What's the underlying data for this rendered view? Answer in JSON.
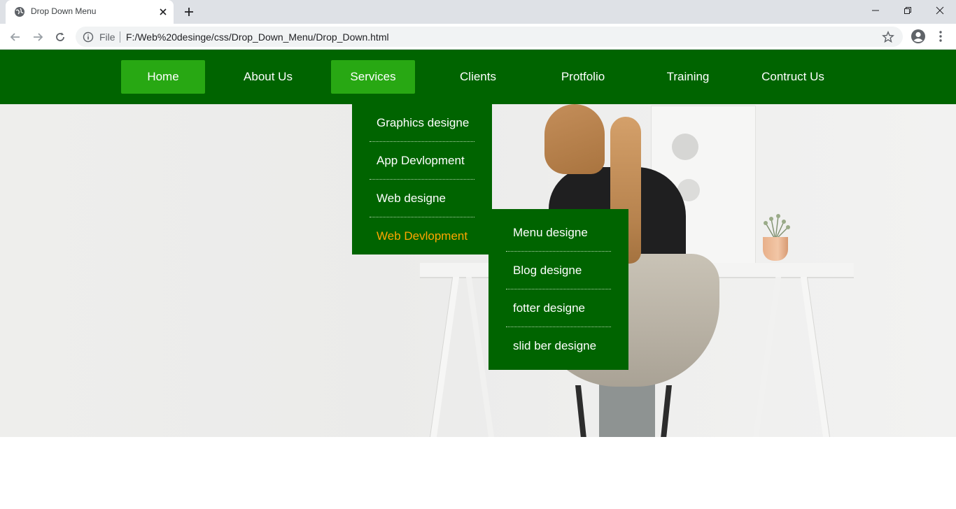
{
  "browser": {
    "tab_title": "Drop Down Menu",
    "url_scheme_label": "File",
    "url": "F:/Web%20desinge/css/Drop_Down_Menu/Drop_Down.html",
    "icons": [
      "globe-icon",
      "close-icon",
      "plus-icon",
      "minimize-icon",
      "restore-icon",
      "window-close-icon",
      "back-icon",
      "forward-icon",
      "reload-icon",
      "info-icon",
      "star-icon",
      "profile-icon",
      "more-vertical-icon"
    ]
  },
  "nav": {
    "items": [
      {
        "label": "Home",
        "active": true
      },
      {
        "label": "About Us",
        "active": false
      },
      {
        "label": "Services",
        "active": true
      },
      {
        "label": "Clients",
        "active": false
      },
      {
        "label": "Protfolio",
        "active": false
      },
      {
        "label": "Training",
        "active": false
      },
      {
        "label": "Contruct Us",
        "active": false
      }
    ]
  },
  "dropdown": {
    "items": [
      {
        "label": "Graphics designe"
      },
      {
        "label": "App Devlopment"
      },
      {
        "label": "Web designe"
      },
      {
        "label": "Web Devlopment"
      }
    ]
  },
  "submenu": {
    "items": [
      {
        "label": "Menu designe"
      },
      {
        "label": "Blog designe"
      },
      {
        "label": "fotter designe"
      },
      {
        "label": "slid ber designe"
      }
    ]
  },
  "colors": {
    "nav_bg": "#006400",
    "active_bg": "#28a813",
    "hover_text": "#ffa500",
    "text": "#ffffff"
  }
}
